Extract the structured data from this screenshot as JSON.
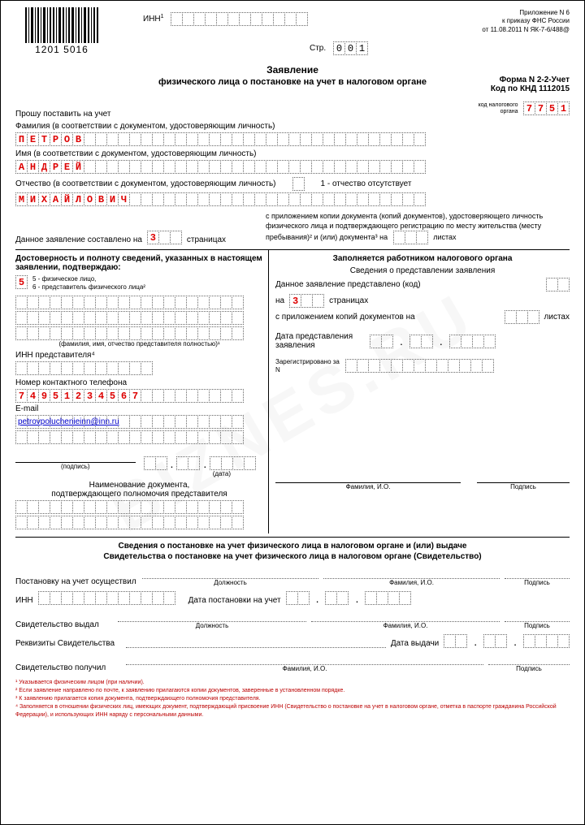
{
  "header": {
    "barcode_text": "1201 5016",
    "inn_label": "ИНН",
    "page_label": "Стр.",
    "page_digits": [
      "0",
      "0",
      "1"
    ],
    "appendix": "Приложение N 6",
    "order": "к приказу ФНС России",
    "date": "от 11.08.2011 N ЯК-7-6/488@"
  },
  "title": "Заявление",
  "subtitle": "физического лица о постановке на учет в налоговом органе",
  "form_code_1": "Форма N 2-2-Учет",
  "form_code_2": "Код по КНД 1112015",
  "tax_org_label": "код налогового\nоргана",
  "tax_org_digits": [
    "7",
    "7",
    "5",
    "1"
  ],
  "request_label": "Прошу поставить на учет",
  "surname_label": "Фамилия (в соответствии с документом, удостоверяющим личность)",
  "surname": [
    "П",
    "Е",
    "Т",
    "Р",
    "О",
    "В"
  ],
  "name_label": "Имя (в соответствии с документом, удостоверяющим личность)",
  "name": [
    "А",
    "Н",
    "Д",
    "Р",
    "Е",
    "Й"
  ],
  "patronymic_label": "Отчество (в соответствии с документом, удостоверяющим личность)",
  "patronymic_note": "1 - отчество отсутствует",
  "patronymic": [
    "М",
    "И",
    "Х",
    "А",
    "Й",
    "Л",
    "О",
    "В",
    "И",
    "Ч"
  ],
  "pages_line_left": "Данное заявление составлено на",
  "pages_count": "3",
  "pages_line_right": "страницах",
  "pages_note": "с приложением копии документа (копий документов), удостоверяющего личность физического лица и подтверждающего регистрацию по месту жительства (месту пребывания)² и (или) документа³ на",
  "pages_sheets": "листах",
  "left_block": {
    "title": "Достоверность и полноту сведений, указанных в настоящем заявлении, подтверждаю:",
    "opt5": "5 - физическое лицо,",
    "opt6": "6 - представитель физического лица²",
    "selected": "5",
    "fio_note": "(фамилия, имя, отчество представителя полностью)¹",
    "inn_rep": "ИНН представителя⁴",
    "phone_label": "Номер контактного телефона",
    "phone": [
      "7",
      "4",
      "9",
      "5",
      "1",
      "2",
      "3",
      "4",
      "5",
      "6",
      "7"
    ],
    "email_label": "E-mail",
    "email": "petrovpoluchenieinn@inn.ru",
    "sig": "(подпись)",
    "date": "(дата)",
    "doc_title": "Наименование документа,\nподтверждающего полномочия представителя"
  },
  "right_block": {
    "title": "Заполняется работником налогового органа",
    "sub": "Сведения о представлении заявления",
    "line1": "Данное заявление представлено (код)",
    "line2a": "на",
    "line2_val": "3",
    "line2b": "страницах",
    "line3": "с приложением копий документов на",
    "line3b": "листах",
    "date_label": "Дата представления заявления",
    "reg_label": "Зарегистрировано за N",
    "fio": "Фамилия, И.О.",
    "sig": "Подпись"
  },
  "reg": {
    "title1": "Сведения о постановке на учет физического лица в налоговом органе и (или) выдаче",
    "title2": "Свидетельства о постановке на учет физического лица в налоговом органе (Свидетельство)",
    "r1": "Постановку на учет осуществил",
    "position": "Должность",
    "fio": "Фамилия, И.О.",
    "sig": "Подпись",
    "inn": "ИНН",
    "reg_date": "Дата постановки на учет",
    "r2": "Свидетельство выдал",
    "r3": "Реквизиты Свидетельства",
    "issue_date": "Дата выдачи",
    "r4": "Свидетельство получил"
  },
  "footnotes": {
    "f1": "¹ Указывается физическим лицом (при наличии).",
    "f2": "² Если заявление направлено по почте, к заявлению прилагаются копии документов, заверенные в установленном порядке.",
    "f3": "³ К заявлению прилагается копия документа, подтверждающего полномочия представителя.",
    "f4": "⁴ Заполняется в отношении физических лиц, имеющих документ, подтверждающий присвоение ИНН (Свидетельство о постановке на учет в налоговом органе, отметка в паспорте гражданина Российской Федерации), и использующих ИНН наряду с персональными данными."
  }
}
